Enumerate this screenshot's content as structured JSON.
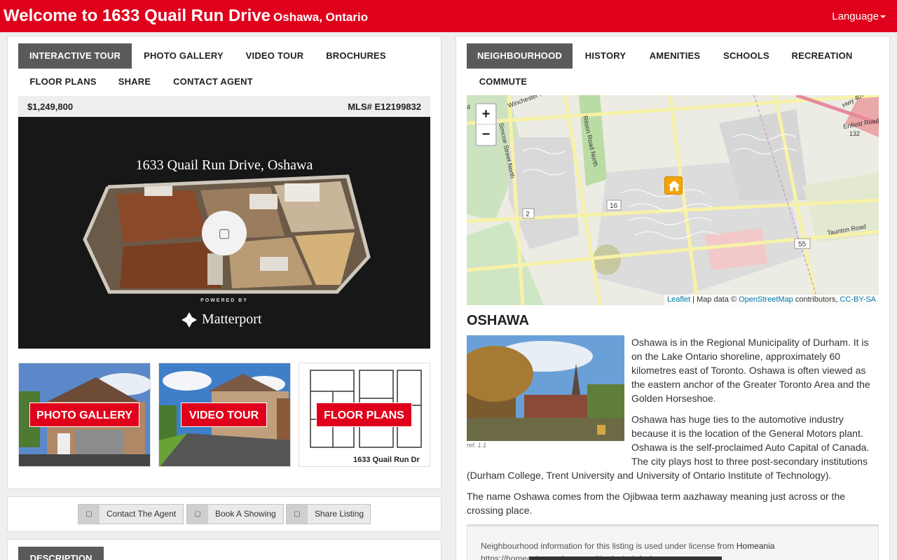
{
  "header": {
    "title": "Welcome to 1633 Quail Run Drive",
    "city": "Oshawa, Ontario",
    "language_label": "Language"
  },
  "left_tabs": [
    "INTERACTIVE TOUR",
    "PHOTO GALLERY",
    "VIDEO TOUR",
    "BROCHURES",
    "FLOOR PLANS",
    "SHARE",
    "CONTACT AGENT"
  ],
  "listing": {
    "price": "$1,249,800",
    "mls": "MLS# E12199832"
  },
  "tour": {
    "title": "1633 Quail Run Drive, Oshawa",
    "powered_by": "POWERED BY",
    "brand": "Matterport"
  },
  "thumbnails": {
    "photo_gallery": "PHOTO GALLERY",
    "video_tour": "VIDEO TOUR",
    "floor_plans": "FLOOR PLANS",
    "floorplan_caption": "1633 Quail Run Dr"
  },
  "actions": {
    "contact": "Contact The Agent",
    "showing": "Book A Showing",
    "share": "Share Listing"
  },
  "description_tab": "DESCRIPTION",
  "right_tabs": [
    "NEIGHBOURHOOD",
    "HISTORY",
    "AMENITIES",
    "SCHOOLS",
    "RECREATION",
    "COMMUTE"
  ],
  "map": {
    "zoom_in": "+",
    "zoom_out": "−",
    "labels": {
      "winchester": "Winchester Road E",
      "simcoe": "Simcoe Street North",
      "ritson": "Ritson Road North",
      "enfield": "Enfield Road",
      "taunton": "Taunton Road",
      "hwy407": "Hwy 407",
      "r132": "132",
      "r2": "2",
      "r16": "16",
      "r55": "55",
      "r4": "4"
    },
    "attribution": {
      "leaflet": "Leaflet",
      "mid": "| Map data ©",
      "osm": "OpenStreetMap",
      "contrib": "contributors,",
      "license": "CC-BY-SA"
    }
  },
  "neighbourhood": {
    "title": "OSHAWA",
    "ref": "ref. 1.1",
    "p1": "Oshawa is in the Regional Municipality of Durham. It is on the Lake Ontario shoreline, approximately 60 kilometres east of Toronto. Oshawa is often viewed as the eastern anchor of the Greater Toronto Area and the Golden Horseshoe.",
    "p2_a": "Oshawa has huge ties to the automotive industry because it is the location of the General Motors plant. Oshawa is the self-proclaimed Auto Capital of Canada. The city plays host to three post-secondary institutions",
    "p2_b": "(Durham College, Trent University and University of Ontario Institute of Technology).",
    "p3": "The name Oshawa comes from the Ojibwaa term aazhaway meaning just across or the crossing place.",
    "license_text": "Neighbourhood information for this listing is used under license from",
    "license_source": "Homeania",
    "license_url": "https://homeania.com/communities/ontario/oshawa"
  },
  "colors": {
    "brand_red": "#e0001b",
    "active_tab": "#5a5a5a"
  }
}
